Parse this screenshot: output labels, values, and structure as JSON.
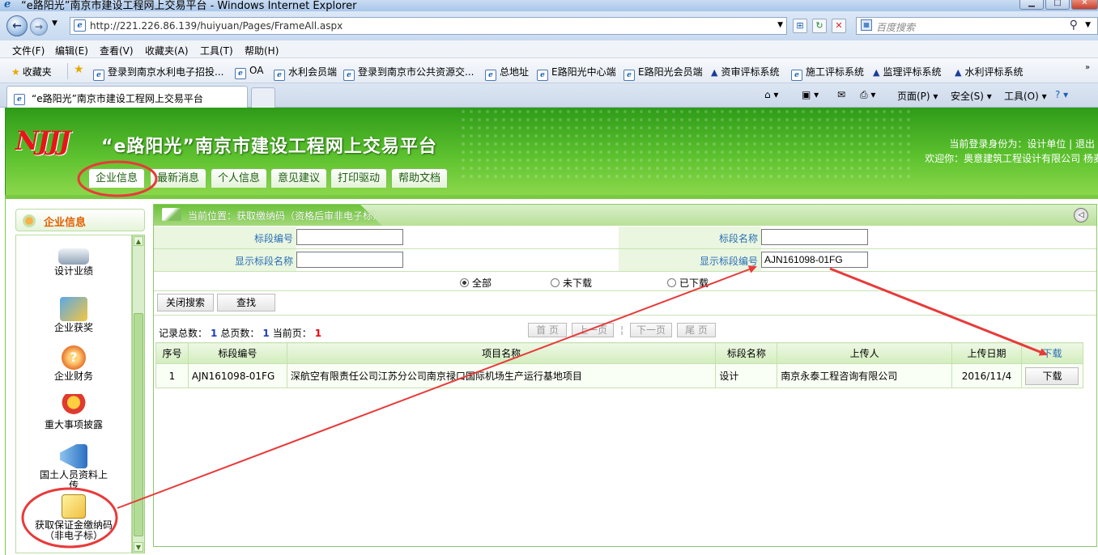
{
  "window": {
    "title": "“e路阳光”南京市建设工程网上交易平台 - Windows Internet Explorer"
  },
  "address": {
    "url": "http://221.226.86.139/huiyuan/Pages/FrameAll.aspx",
    "search_placeholder": "百度搜索"
  },
  "menu": [
    "文件(F)",
    "编辑(E)",
    "查看(V)",
    "收藏夹(A)",
    "工具(T)",
    "帮助(H)"
  ],
  "favorites": {
    "label": "收藏夹",
    "items": [
      "登录到南京水利电子招投...",
      "OA",
      "水利会员端",
      "登录到南京市公共资源交...",
      "总地址",
      "E路阳光中心端",
      "E路阳光会员端",
      "资审评标系统",
      "施工评标系统",
      "监理评标系统",
      "水利评标系统"
    ]
  },
  "browser_tab": {
    "title": "“e路阳光”南京市建设工程网上交易平台"
  },
  "commands": {
    "page": "页面(P)",
    "safety": "安全(S)",
    "tools": "工具(O)"
  },
  "site": {
    "title": "“e路阳光”南京市建设工程网上交易平台",
    "user_role": "当前登录身份为：设计单位 | 退出",
    "welcome": "欢迎你：奥意建筑工程设计有限公司  杨麦",
    "nav_tabs": [
      "企业信息",
      "最新消息",
      "个人信息",
      "意见建议",
      "打印驱动",
      "帮助文档"
    ]
  },
  "sidebar": {
    "header": "企业信息",
    "items": [
      "设计业绩",
      "企业获奖",
      "企业财务",
      "重大事项披露",
      "国土人员资料上传",
      "获取保证金缴纳码（非电子标）"
    ]
  },
  "main": {
    "location": "当前位置：获取缴纳码（资格后审非电子标）",
    "form": {
      "section_no_label": "标段编号",
      "section_no_value": "",
      "section_name_label": "标段名称",
      "section_name_value": "",
      "show_section_name_label": "显示标段名称",
      "show_section_name_value": "",
      "show_section_no_label": "显示标段编号",
      "show_section_no_value": "AJN161098-01FG"
    },
    "filters": {
      "all": "全部",
      "not_downloaded": "未下载",
      "downloaded": "已下载",
      "selected": "all"
    },
    "buttons": {
      "close_search": "关闭搜索",
      "search": "查找"
    },
    "pager": {
      "total_label": "记录总数：",
      "total": "1",
      "pages_label": "总页数：",
      "pages": "1",
      "current_label": "当前页：",
      "current": "1",
      "first": "首 页",
      "prev": "上一页",
      "next": "下一页",
      "last": "尾 页"
    },
    "table": {
      "headers": [
        "序号",
        "标段编号",
        "项目名称",
        "标段名称",
        "上传人",
        "上传日期",
        "下载"
      ],
      "rows": [
        [
          "1",
          "AJN161098-01FG",
          "深航空有限责任公司江苏分公司南京禄口国际机场生产运行基地项目",
          "设计",
          "南京永泰工程咨询有限公司",
          "2016/11/4",
          "下载"
        ]
      ]
    }
  },
  "colors": {
    "header_green": "#5ec22f",
    "accent_red": "#e83a3a",
    "link_blue": "#2b6fb5"
  }
}
